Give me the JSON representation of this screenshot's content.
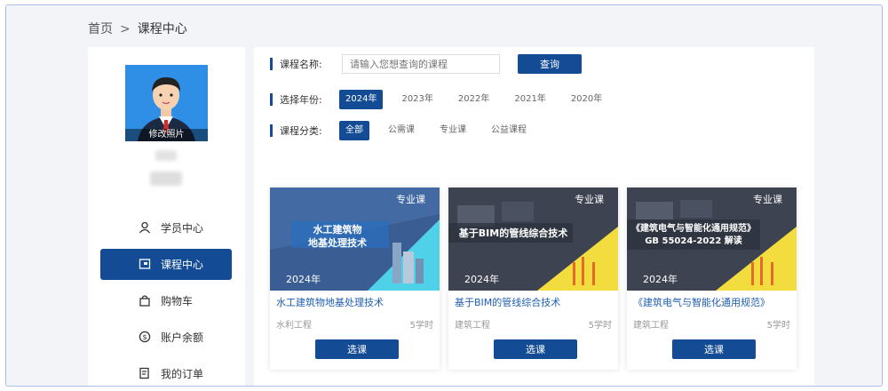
{
  "breadcrumb": {
    "home": "首页",
    "separator": ">",
    "current": "课程中心"
  },
  "profile": {
    "edit_photo": "修改照片"
  },
  "menu": [
    {
      "label": "学员中心",
      "icon": "user-icon",
      "active": false
    },
    {
      "label": "课程中心",
      "icon": "course-icon",
      "active": true
    },
    {
      "label": "购物车",
      "icon": "cart-icon",
      "active": false
    },
    {
      "label": "账户余额",
      "icon": "balance-icon",
      "active": false
    },
    {
      "label": "我的订单",
      "icon": "order-icon",
      "active": false
    }
  ],
  "search": {
    "label": "课程名称:",
    "placeholder": "请输入您想查询的课程",
    "button": "查询"
  },
  "year_filter": {
    "label": "选择年份:",
    "options": [
      "2024年",
      "2023年",
      "2022年",
      "2021年",
      "2020年"
    ],
    "selected": "2024年"
  },
  "category_filter": {
    "label": "课程分类:",
    "options": [
      "全部",
      "公需课",
      "专业课",
      "公益课程"
    ],
    "selected": "全部"
  },
  "colors": {
    "accent": "#134c95",
    "link": "#1f5fae"
  },
  "courses": [
    {
      "tag": "专业课",
      "year": "2024年",
      "cover_title": "水工建筑物\n地基处理技术",
      "title": "水工建筑物地基处理技术",
      "category": "水利工程",
      "hours": "5学时",
      "button": "选课"
    },
    {
      "tag": "专业课",
      "year": "2024年",
      "cover_title": "基于BIM的管线综合技术",
      "title": "基于BIM的管线综合技术",
      "category": "建筑工程",
      "hours": "5学时",
      "button": "选课"
    },
    {
      "tag": "专业课",
      "year": "2024年",
      "cover_title": "《建筑电气与智能化通用规范》\nGB 55024-2022 解读",
      "title": "《建筑电气与智能化通用规范》",
      "category": "建筑工程",
      "hours": "5学时",
      "button": "选课"
    }
  ]
}
